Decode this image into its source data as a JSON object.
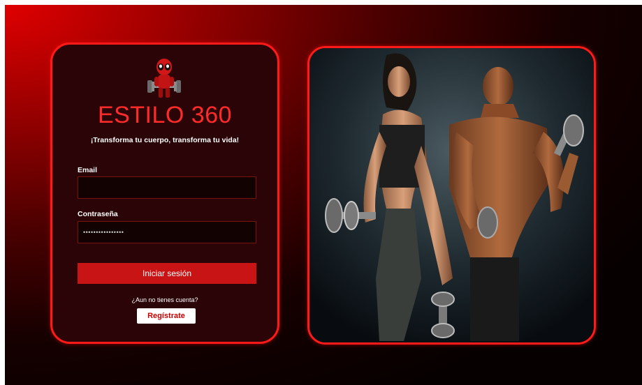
{
  "login": {
    "brand": "ESTILO 360",
    "tagline": "¡Transforma tu cuerpo, transforma tu vida!",
    "email_label": "Email",
    "email_value": "",
    "password_label": "Contraseña",
    "password_value": "••••••••••••••••",
    "login_button": "Iniciar sesión",
    "no_account_text": "¿Aun no tienes cuenta?",
    "register_button": "Regístrate"
  },
  "colors": {
    "accent": "#ff1a1a",
    "button": "#c81414",
    "card_background": "#2a0406"
  },
  "icons": {
    "logo": "mascot-lifting-barbell-icon"
  }
}
